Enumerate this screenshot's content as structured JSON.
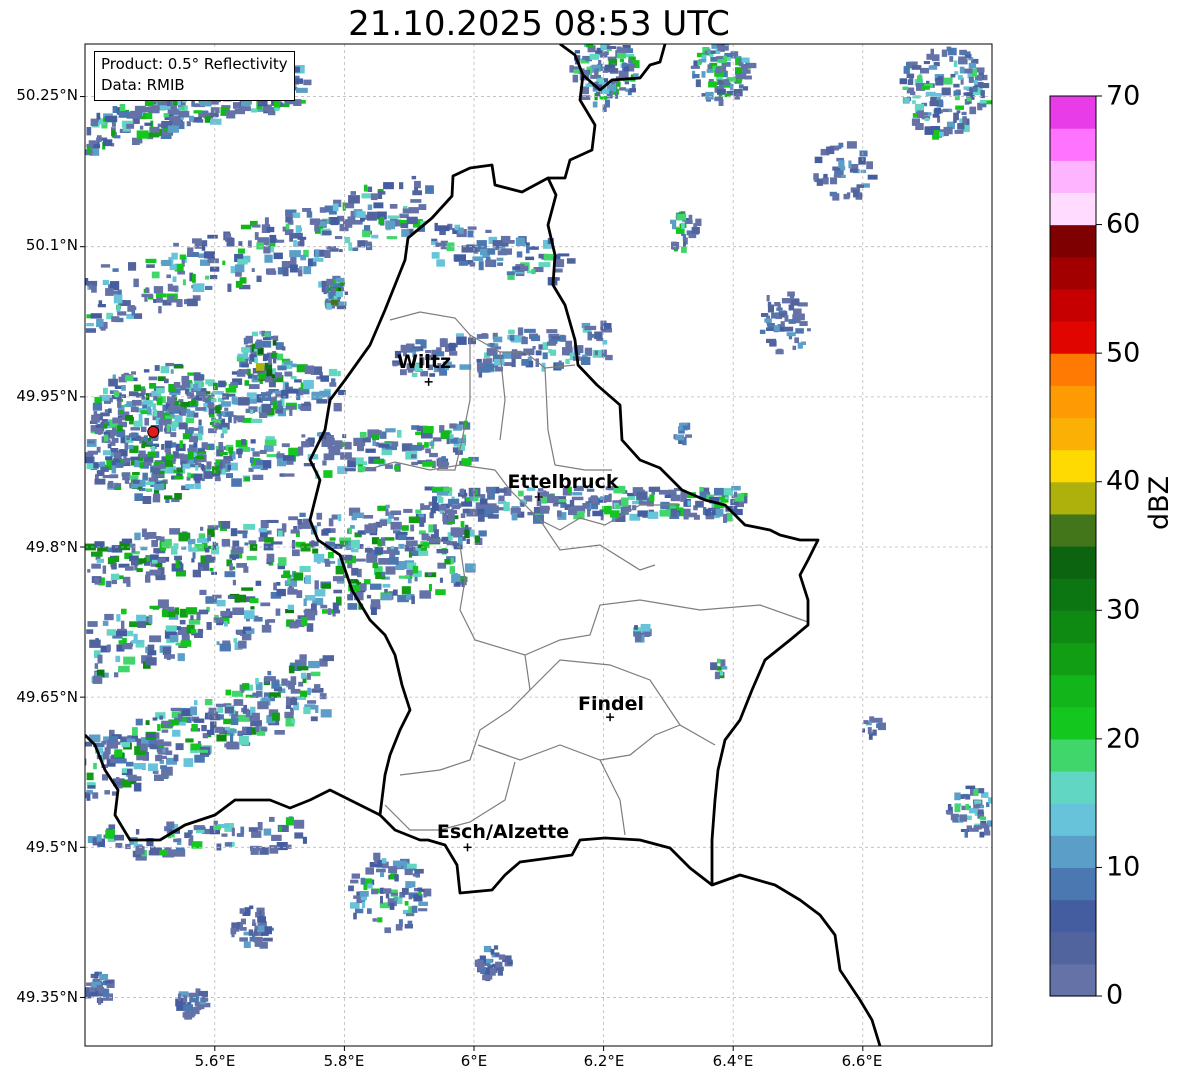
{
  "title": "21.10.2025 08:53 UTC",
  "info": {
    "product": "Product: 0.5° Reflectivity",
    "data": "Data: RMIB"
  },
  "axes": {
    "lat_ticks": [
      "50.25°N",
      "50.1°N",
      "49.95°N",
      "49.8°N",
      "49.65°N",
      "49.5°N",
      "49.35°N"
    ],
    "lon_ticks": [
      "5.6°E",
      "5.8°E",
      "6°E",
      "6.2°E",
      "6.4°E",
      "6.6°E"
    ]
  },
  "cities": [
    {
      "name": "Wiltz",
      "lon": 5.93,
      "lat": 49.965
    },
    {
      "name": "Ettelbruck",
      "lon": 6.1,
      "lat": 49.85
    },
    {
      "name": "Findel",
      "lon": 6.21,
      "lat": 49.63
    },
    {
      "name": "Esch/Alzette",
      "lon": 5.99,
      "lat": 49.5
    }
  ],
  "radar_site": {
    "lon": 5.505,
    "lat": 49.915,
    "color": "#e31a1c"
  },
  "colorbar": {
    "unit": "dBZ",
    "tick_labels": [
      "0",
      "10",
      "20",
      "30",
      "40",
      "50",
      "60",
      "70"
    ],
    "colors": [
      "#6572a8",
      "#52649e",
      "#445da0",
      "#4b78b0",
      "#5b9fc9",
      "#67c3d9",
      "#61d6c2",
      "#40d66c",
      "#14c71e",
      "#12b51a",
      "#119e15",
      "#0e8a12",
      "#0c7712",
      "#0c6410",
      "#43761a",
      "#aeb00b",
      "#fed902",
      "#fbb005",
      "#fd9a04",
      "#ff7a02",
      "#e10500",
      "#c60000",
      "#a20000",
      "#7e0000",
      "#ffdcff",
      "#ffb4ff",
      "#ff73ff",
      "#e83ce8"
    ]
  }
}
